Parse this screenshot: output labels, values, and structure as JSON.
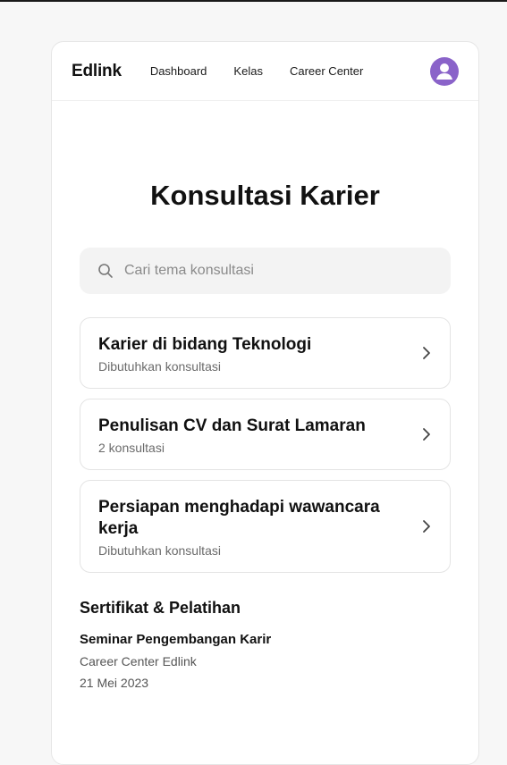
{
  "nav": {
    "brand": "Edlink",
    "links": [
      "Dashboard",
      "Kelas",
      "Career Center"
    ],
    "avatar_icon": "user-icon",
    "accent_color": "#8a63c9"
  },
  "main": {
    "title": "Konsultasi Karier",
    "search": {
      "placeholder": "Cari tema konsultasi",
      "value": "",
      "icon": "search-icon"
    },
    "topics": [
      {
        "title": "Karier di bidang Teknologi",
        "subtitle": "Dibutuhkan konsultasi"
      },
      {
        "title": "Penulisan CV dan Surat Lamaran",
        "subtitle": "2 konsultasi"
      },
      {
        "title": "Persiapan menghadapi wawancara kerja",
        "subtitle": "Dibutuhkan konsultasi"
      }
    ]
  },
  "certificates": {
    "section_title": "Sertifikat & Pelatihan",
    "event": {
      "title": "Seminar Pengembangan Karir",
      "organizer": "Career Center Edlink",
      "date": "21 Mei 2023"
    }
  }
}
